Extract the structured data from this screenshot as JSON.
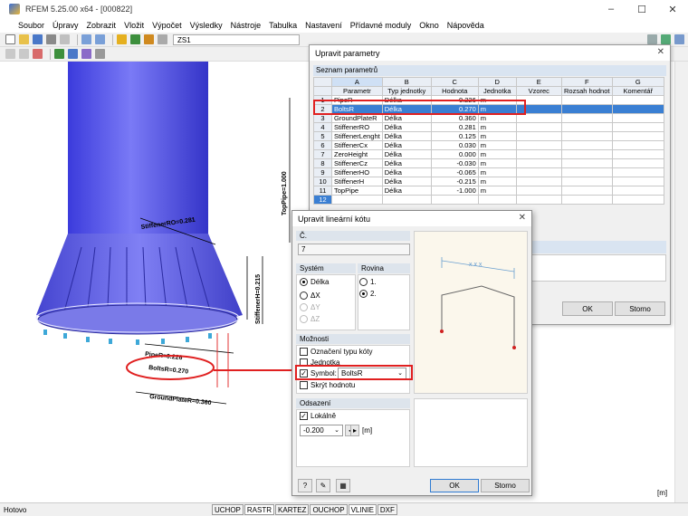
{
  "window": {
    "title": "RFEM 5.25.00 x64 - [000822]",
    "min": "–",
    "max": "☐",
    "close": "✕"
  },
  "menu": [
    "Soubor",
    "Úpravy",
    "Zobrazit",
    "Vložit",
    "Výpočet",
    "Výsledky",
    "Nástroje",
    "Tabulka",
    "Nastavení",
    "Přídavné moduly",
    "Okno",
    "Nápověda"
  ],
  "toolbar": {
    "zs": "ZS1"
  },
  "model": {
    "labels": {
      "stiffener_ro": "StiffenerRO=0.281",
      "top_pipe": "TopPipe=1.000",
      "stiffener_h": "StiffenerH=0.215",
      "pipe_r": "PipeR=0.226",
      "bolts_r": "BoltsR=0.270",
      "ground_plate_r": "GroundPlateR=0.360"
    },
    "unit": "[m]"
  },
  "param_dialog": {
    "title": "Upravit parametry",
    "section": "Seznam parametrů",
    "col_letters": [
      "A",
      "B",
      "C",
      "D",
      "E",
      "F",
      "G"
    ],
    "col_headers": [
      "Parametr",
      "Typ jednotky",
      "Hodnota",
      "Jednotka",
      "Vzorec",
      "Rozsah hodnot",
      "Komentář"
    ],
    "rows": [
      {
        "n": "1",
        "name": "PipeR",
        "type": "Délka",
        "value": "0.226",
        "unit": "m"
      },
      {
        "n": "2",
        "name": "BoltsR",
        "type": "Délka",
        "value": "0.270",
        "unit": "m"
      },
      {
        "n": "3",
        "name": "GroundPlateR",
        "type": "Délka",
        "value": "0.360",
        "unit": "m"
      },
      {
        "n": "4",
        "name": "StiffenerRO",
        "type": "Délka",
        "value": "0.281",
        "unit": "m"
      },
      {
        "n": "5",
        "name": "StiffenerLenght",
        "type": "Délka",
        "value": "0.125",
        "unit": "m"
      },
      {
        "n": "6",
        "name": "StiffenerCx",
        "type": "Délka",
        "value": "0.030",
        "unit": "m"
      },
      {
        "n": "7",
        "name": "ZeroHeight",
        "type": "Délka",
        "value": "0.000",
        "unit": "m"
      },
      {
        "n": "8",
        "name": "StiffenerCz",
        "type": "Délka",
        "value": "-0.030",
        "unit": "m"
      },
      {
        "n": "9",
        "name": "StiffenerHO",
        "type": "Délka",
        "value": "-0.065",
        "unit": "m"
      },
      {
        "n": "10",
        "name": "StiffenerH",
        "type": "Délka",
        "value": "-0.215",
        "unit": "m"
      },
      {
        "n": "11",
        "name": "TopPipe",
        "type": "Délka",
        "value": "-1.000",
        "unit": "m"
      },
      {
        "n": "12",
        "name": "",
        "type": "",
        "value": "",
        "unit": ""
      }
    ],
    "selected_row": 1,
    "ok": "OK",
    "cancel": "Storno"
  },
  "dim_dialog": {
    "title": "Upravit lineární kótu",
    "no_label": "Č.",
    "no_value": "7",
    "system_label": "Systém",
    "system_options": [
      "Délka",
      "ΔX",
      "ΔY",
      "ΔZ"
    ],
    "plane_label": "Rovina",
    "plane_options": [
      "1.",
      "2."
    ],
    "options_label": "Možnosti",
    "opt_unit_type": "Označení typu kóty",
    "opt_unit": "Jednotka",
    "opt_symbol": "Symbol:",
    "symbol_value": "BoltsR",
    "opt_hide_value": "Skrýt hodnotu",
    "offset_label": "Odsazení",
    "offset_local": "Lokálně",
    "offset_value": "-0.200",
    "offset_unit": "[m]",
    "preview_label": "x x x",
    "ok": "OK",
    "cancel": "Storno"
  },
  "statusbar": {
    "text": "Hotovo",
    "buttons": [
      "UCHOP",
      "RASTR",
      "KARTEZ",
      "OUCHOP",
      "VLINIE",
      "DXF"
    ]
  },
  "colors": {
    "accent": "#3a7fd3",
    "highlight": "#e02020",
    "pipe": "#5a5af0",
    "support": "#3da8d8"
  }
}
